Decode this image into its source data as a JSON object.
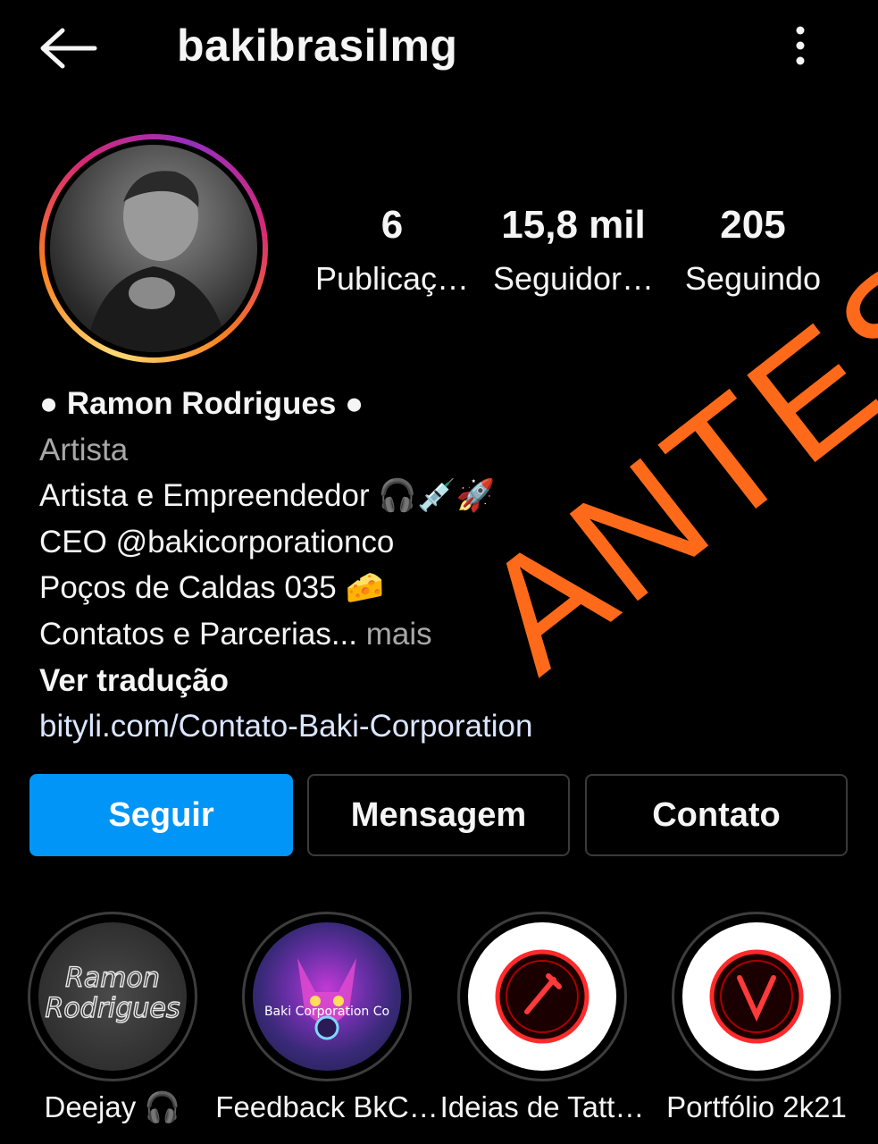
{
  "header": {
    "username": "bakibrasilmg"
  },
  "stats": {
    "posts": {
      "value": "6",
      "label": "Publicaç…"
    },
    "followers": {
      "value": "15,8 mil",
      "label": "Seguidor…"
    },
    "following": {
      "value": "205",
      "label": "Seguindo"
    }
  },
  "bio": {
    "name": "● Ramon Rodrigues ●",
    "category": "Artista",
    "line1": "Artista e Empreendedor 🎧💉🚀",
    "line2": "CEO @bakicorporationco",
    "line3": "Poços de Caldas 035 🧀",
    "line4": "Contatos e Parcerias...",
    "more": " mais",
    "translate": "Ver tradução",
    "link": "bityli.com/Contato-Baki-Corporation"
  },
  "buttons": {
    "follow": "Seguir",
    "message": "Mensagem",
    "contact": "Contato"
  },
  "highlights": [
    {
      "label": "Deejay 🎧",
      "cover_text_1": "Ramon",
      "cover_text_2": "Rodrigues"
    },
    {
      "label": "Feedback BkC…",
      "cover_text": "Baki Corporation Co"
    },
    {
      "label": "Ideias de Tatt…"
    },
    {
      "label": "Portfólio 2k21"
    }
  ],
  "watermark": {
    "text": "ANTES",
    "color": "#ff6a1a"
  },
  "colors": {
    "background": "#000000",
    "follow_button": "#0095f6",
    "link": "#dbe6ff"
  }
}
